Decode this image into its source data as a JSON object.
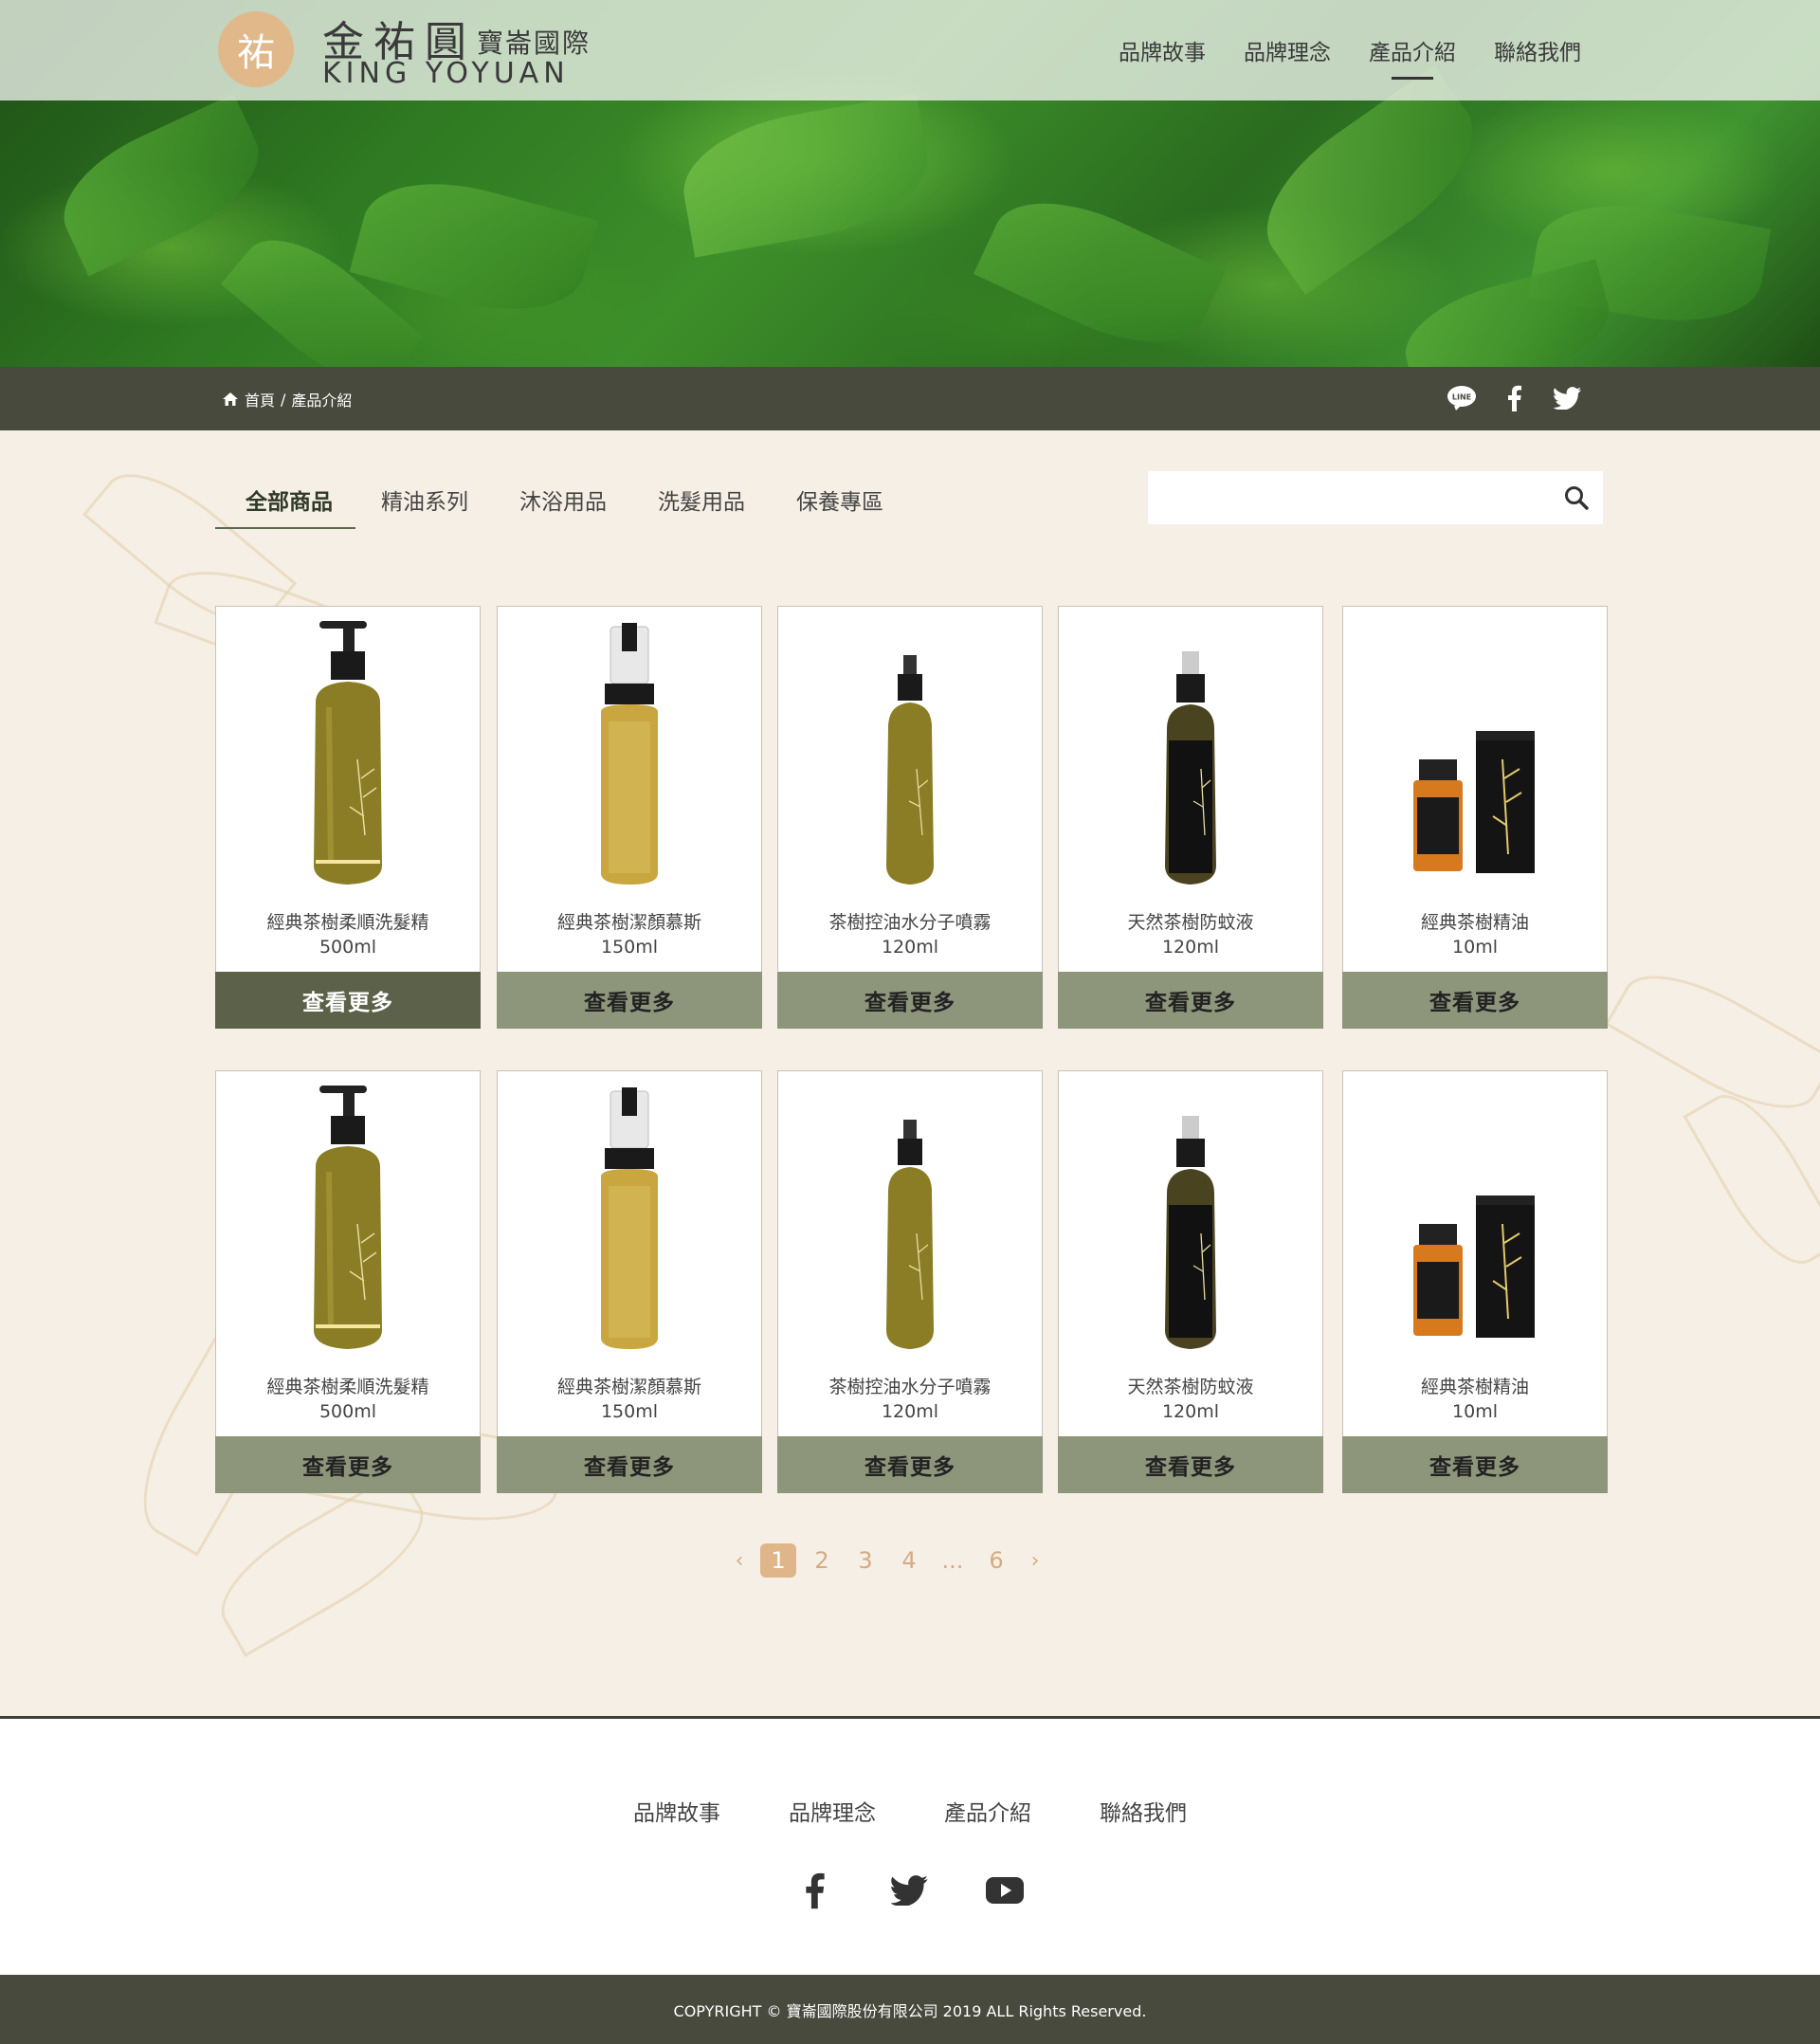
{
  "brand": {
    "logo_glyph": "祐",
    "name_cn": "金祐圓",
    "name_cn_sub": "寶崙國際",
    "name_en": "KING YOYUAN"
  },
  "nav": {
    "items": [
      {
        "label": "品牌故事",
        "active": false
      },
      {
        "label": "品牌理念",
        "active": false
      },
      {
        "label": "產品介紹",
        "active": true
      },
      {
        "label": "聯絡我們",
        "active": false
      }
    ]
  },
  "breadcrumb": {
    "home": "首頁",
    "separator": "/",
    "current": "產品介紹"
  },
  "social_top": [
    "line-icon",
    "facebook-icon",
    "twitter-icon"
  ],
  "category_tabs": [
    {
      "label": "全部商品",
      "active": true
    },
    {
      "label": "精油系列",
      "active": false
    },
    {
      "label": "沐浴用品",
      "active": false
    },
    {
      "label": "洗髮用品",
      "active": false
    },
    {
      "label": "保養專區",
      "active": false
    }
  ],
  "search": {
    "placeholder": "",
    "value": ""
  },
  "products": [
    {
      "name": "經典茶樹柔順洗髮精",
      "volume": "500ml",
      "button": "查看更多",
      "type": "pump"
    },
    {
      "name": "經典茶樹潔顏慕斯",
      "volume": "150ml",
      "button": "查看更多",
      "type": "foam"
    },
    {
      "name": "茶樹控油水分子噴霧",
      "volume": "120ml",
      "button": "查看更多",
      "type": "spray"
    },
    {
      "name": "天然茶樹防蚊液",
      "volume": "120ml",
      "button": "查看更多",
      "type": "spray-dark"
    },
    {
      "name": "經典茶樹精油",
      "volume": "10ml",
      "button": "查看更多",
      "type": "oil"
    },
    {
      "name": "經典茶樹柔順洗髮精",
      "volume": "500ml",
      "button": "查看更多",
      "type": "pump"
    },
    {
      "name": "經典茶樹潔顏慕斯",
      "volume": "150ml",
      "button": "查看更多",
      "type": "foam"
    },
    {
      "name": "茶樹控油水分子噴霧",
      "volume": "120ml",
      "button": "查看更多",
      "type": "spray"
    },
    {
      "name": "天然茶樹防蚊液",
      "volume": "120ml",
      "button": "查看更多",
      "type": "spray-dark"
    },
    {
      "name": "經典茶樹精油",
      "volume": "10ml",
      "button": "查看更多",
      "type": "oil"
    }
  ],
  "pagination": {
    "prev": "‹",
    "pages": [
      "1",
      "2",
      "3",
      "4",
      "...",
      "6"
    ],
    "current": "1",
    "next": "›"
  },
  "footer": {
    "nav": [
      "品牌故事",
      "品牌理念",
      "產品介紹",
      "聯絡我們"
    ],
    "social": [
      "facebook-icon",
      "twitter-icon",
      "youtube-icon"
    ],
    "copyright": "COPYRIGHT © 寶崙國際股份有限公司 2019 ALL Rights Reserved."
  },
  "colors": {
    "accent_dark": "#474a3d",
    "button_olive": "#8d957a",
    "button_active": "#5c6249",
    "pager": "#d4ab82",
    "background": "#f6efe5"
  }
}
